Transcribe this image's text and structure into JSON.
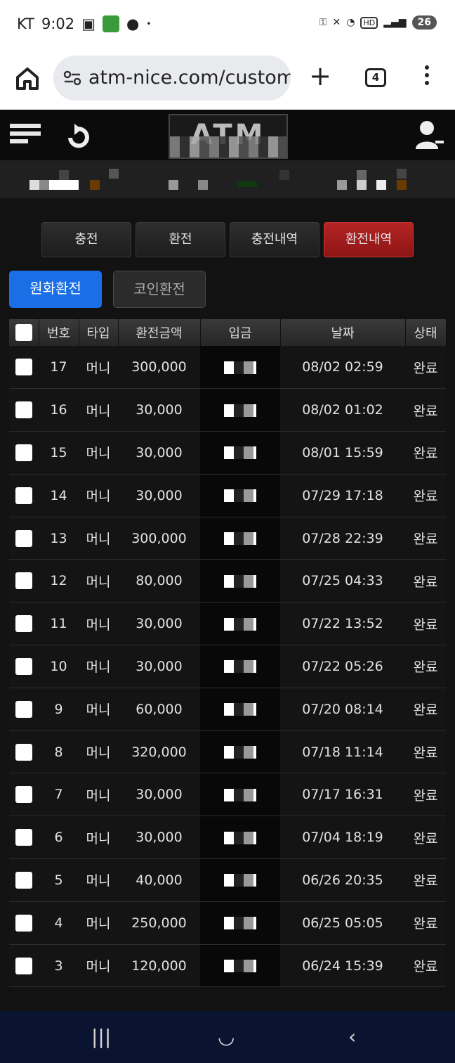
{
  "status_bar": {
    "carrier": "KT",
    "time": "9:02",
    "battery": "26"
  },
  "browser": {
    "url": "atm-nice.com/custom",
    "tab_count": "4"
  },
  "site": {
    "logo_text": "ATM"
  },
  "top_tabs": [
    {
      "label": "충전",
      "active": false
    },
    {
      "label": "환전",
      "active": false
    },
    {
      "label": "충전내역",
      "active": false
    },
    {
      "label": "환전내역",
      "active": true
    }
  ],
  "sub_tabs": [
    {
      "label": "원화환전",
      "active": true
    },
    {
      "label": "코인환전",
      "active": false
    }
  ],
  "table": {
    "headers": [
      "",
      "번호",
      "타입",
      "환전금액",
      "입금",
      "날짜",
      "상태"
    ],
    "rows": [
      {
        "no": "17",
        "type": "머니",
        "amount": "300,000",
        "date": "08/02 02:59",
        "status": "완료"
      },
      {
        "no": "16",
        "type": "머니",
        "amount": "30,000",
        "date": "08/02 01:02",
        "status": "완료"
      },
      {
        "no": "15",
        "type": "머니",
        "amount": "30,000",
        "date": "08/01 15:59",
        "status": "완료"
      },
      {
        "no": "14",
        "type": "머니",
        "amount": "30,000",
        "date": "07/29 17:18",
        "status": "완료"
      },
      {
        "no": "13",
        "type": "머니",
        "amount": "300,000",
        "date": "07/28 22:39",
        "status": "완료"
      },
      {
        "no": "12",
        "type": "머니",
        "amount": "80,000",
        "date": "07/25 04:33",
        "status": "완료"
      },
      {
        "no": "11",
        "type": "머니",
        "amount": "30,000",
        "date": "07/22 13:52",
        "status": "완료"
      },
      {
        "no": "10",
        "type": "머니",
        "amount": "30,000",
        "date": "07/22 05:26",
        "status": "완료"
      },
      {
        "no": "9",
        "type": "머니",
        "amount": "60,000",
        "date": "07/20 08:14",
        "status": "완료"
      },
      {
        "no": "8",
        "type": "머니",
        "amount": "320,000",
        "date": "07/18 11:14",
        "status": "완료"
      },
      {
        "no": "7",
        "type": "머니",
        "amount": "30,000",
        "date": "07/17 16:31",
        "status": "완료"
      },
      {
        "no": "6",
        "type": "머니",
        "amount": "30,000",
        "date": "07/04 18:19",
        "status": "완료"
      },
      {
        "no": "5",
        "type": "머니",
        "amount": "40,000",
        "date": "06/26 20:35",
        "status": "완료"
      },
      {
        "no": "4",
        "type": "머니",
        "amount": "250,000",
        "date": "06/25 05:05",
        "status": "완료"
      },
      {
        "no": "3",
        "type": "머니",
        "amount": "120,000",
        "date": "06/24 15:39",
        "status": "완료"
      }
    ]
  }
}
